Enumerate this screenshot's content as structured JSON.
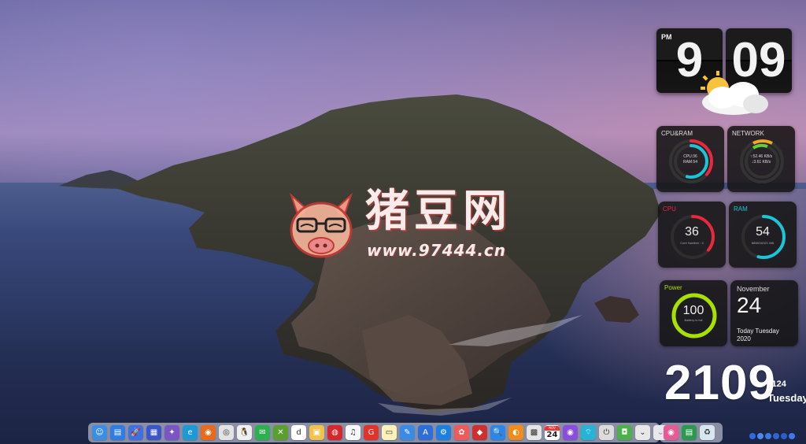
{
  "watermark": {
    "title": "猪豆网",
    "url": "www.97444.cn"
  },
  "flip_clock": {
    "ampm": "PM",
    "hour": "9",
    "minute": "09",
    "weather_icon": "partly-cloudy-icon"
  },
  "widgets": {
    "cpu_ram": {
      "title": "CPU&RAM",
      "line1": "CPU:36",
      "line2": "RAM:54",
      "cpu_fraction": 0.36,
      "ram_fraction": 0.54,
      "cpu_color": "#e8283c",
      "ram_color": "#19c6d8"
    },
    "network": {
      "title": "NETWORK",
      "up": "↑:52.46 KB/s",
      "down": "↓3.61 KB/s",
      "up_color": "#f5a623",
      "down_color": "#5fcf3a"
    },
    "cpu": {
      "title": "CPU",
      "value": "36",
      "sub": "Core Number : 4",
      "fraction": 0.36,
      "color": "#e8283c",
      "title_color": "#e8283c"
    },
    "ram": {
      "title": "RAM",
      "value": "54",
      "sub": "8858/16321 MB",
      "fraction": 0.54,
      "color": "#19c6d8",
      "title_color": "#19c6d8"
    },
    "power": {
      "title": "Power",
      "value": "100",
      "sub": "Battery is full",
      "fraction": 1.0,
      "color": "#a8e000",
      "title_color": "#a8e000"
    },
    "date": {
      "month": "November",
      "day": "24",
      "line1": "Today Tuesday",
      "line2": "2020"
    }
  },
  "big_clock": {
    "time": "2109",
    "date": "1124",
    "weekday": "Tuesday"
  },
  "dock": {
    "apps": [
      {
        "name": "finder-icon",
        "bg": "#3b8ee6",
        "glyph": "☺"
      },
      {
        "name": "app-store-banner-icon",
        "bg": "#2f7de0",
        "glyph": "▤"
      },
      {
        "name": "launchpad-icon",
        "bg": "#3f6fe0",
        "glyph": "🚀"
      },
      {
        "name": "windows-start-icon",
        "bg": "#3a56c9",
        "glyph": "▦"
      },
      {
        "name": "mission-control-icon",
        "bg": "#7a55c8",
        "glyph": "✦"
      },
      {
        "name": "edge-browser-icon",
        "bg": "#1c9ad6",
        "glyph": "e"
      },
      {
        "name": "firefox-icon",
        "bg": "#e86a1a",
        "glyph": "◉"
      },
      {
        "name": "chrome-icon",
        "bg": "#e3e3e3",
        "glyph": "◎"
      },
      {
        "name": "qq-icon",
        "bg": "#f0f0f0",
        "glyph": "🐧"
      },
      {
        "name": "wechat-icon",
        "bg": "#2bb24c",
        "glyph": "✉"
      },
      {
        "name": "xbox-icon",
        "bg": "#5aa02c",
        "glyph": "✕"
      },
      {
        "name": "tiktok-icon",
        "bg": "#ffffff",
        "glyph": "d"
      },
      {
        "name": "app-folder-icon",
        "bg": "#f2c24a",
        "glyph": "▣"
      },
      {
        "name": "netease-music-icon",
        "bg": "#d8262a",
        "glyph": "◍"
      },
      {
        "name": "music-icon",
        "bg": "#fafafa",
        "glyph": "♫"
      },
      {
        "name": "weibo-icon",
        "bg": "#e2332b",
        "glyph": "G"
      },
      {
        "name": "notes-icon",
        "bg": "#fff1b8",
        "glyph": "▭"
      },
      {
        "name": "pen-icon",
        "bg": "#3a8be6",
        "glyph": "✎"
      },
      {
        "name": "xcode-icon",
        "bg": "#2f6ed8",
        "glyph": "A"
      },
      {
        "name": "settings-gear-icon",
        "bg": "#1e7fe0",
        "glyph": "⚙"
      },
      {
        "name": "photos-icon",
        "bg": "#f15a5a",
        "glyph": "✿"
      },
      {
        "name": "red-app-icon",
        "bg": "#d02f2f",
        "glyph": "◆"
      },
      {
        "name": "search-icon",
        "bg": "#2a86e8",
        "glyph": "🔍"
      },
      {
        "name": "orange-app-icon",
        "bg": "#f38b1c",
        "glyph": "◐"
      },
      {
        "name": "games-icon",
        "bg": "#e6e6e6",
        "glyph": "▩"
      },
      {
        "name": "calendar-icon",
        "bg": "#ffffff",
        "glyph": "24",
        "month": "NOV"
      },
      {
        "name": "podcasts-icon",
        "bg": "#8b4ce0",
        "glyph": "◉"
      },
      {
        "name": "wifi-icon",
        "bg": "#26b3d6",
        "glyph": "⌔"
      },
      {
        "name": "power-icon",
        "bg": "#dcdcdc",
        "glyph": "⏻"
      },
      {
        "name": "green-app-icon",
        "bg": "#4bb24a",
        "glyph": "◘"
      },
      {
        "name": "blank-app-icon",
        "bg": "#e8e8e8",
        "glyph": "⌄"
      },
      {
        "name": "blank-app-2-icon",
        "bg": "#e8e8e8",
        "glyph": "⌄"
      }
    ],
    "right_apps": [
      {
        "name": "colorful-app-icon",
        "bg": "#e85a96",
        "glyph": "◉"
      },
      {
        "name": "document-icon",
        "bg": "#2c9a4e",
        "glyph": "▤"
      },
      {
        "name": "recycle-bin-icon",
        "bg": "#d8e6f2",
        "glyph": "♻"
      }
    ]
  }
}
